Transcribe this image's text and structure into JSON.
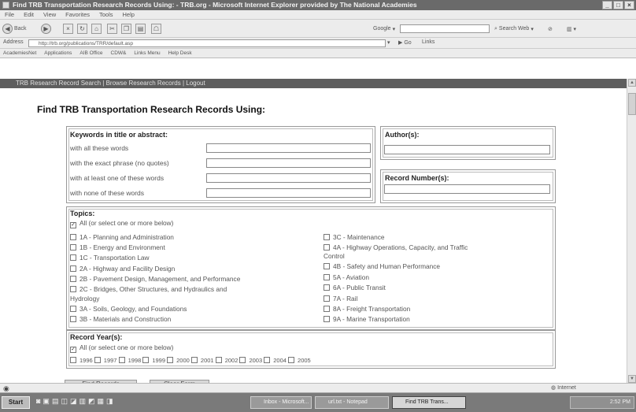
{
  "window": {
    "title": "Find TRB Transportation Research Records Using: - TRB.org - Microsoft Internet Explorer provided by The National Academies"
  },
  "menu": [
    "File",
    "Edit",
    "View",
    "Favorites",
    "Tools",
    "Help"
  ],
  "toolbar": {
    "back_label": "Back",
    "google_label": "Google",
    "search_web_label": "Search Web"
  },
  "address": {
    "label": "Address",
    "url": "http://trb.org/publications/TRR/default.asp",
    "go_label": "Go",
    "links_label": "Links"
  },
  "links": [
    "AcademiesNet",
    "Applications",
    "AIB Office",
    "CDW&",
    "Links Menu",
    "Help Desk"
  ],
  "site_nav": "TRB Research Record Search | Browse Research Records | Logout",
  "page": {
    "heading": "Find TRB Transportation Research Records Using:",
    "keywords": {
      "title": "Keywords in title or abstract:",
      "rows": [
        {
          "label": "with all these words",
          "value": ""
        },
        {
          "label": "with the exact phrase (no quotes)",
          "value": ""
        },
        {
          "label": "with at least one of these words",
          "value": ""
        },
        {
          "label": "with none of these words",
          "value": ""
        }
      ]
    },
    "authors": {
      "title": "Author(s):",
      "value": ""
    },
    "record_numbers": {
      "title": "Record Number(s):",
      "value": ""
    },
    "topics": {
      "title": "Topics:",
      "all_label": "All (or select one or more below)",
      "left": [
        "1A - Planning and Administration",
        "1B - Energy and Environment",
        "1C - Transportation Law",
        "2A - Highway and Facility Design",
        "2B - Pavement Design, Management, and Performance",
        "2C - Bridges, Other Structures, and Hydraulics and",
        "3A - Soils, Geology, and Foundations",
        "3B - Materials and Construction"
      ],
      "left_wrap": "Hydrology",
      "right": [
        "3C - Maintenance",
        "4A - Highway Operations, Capacity, and Traffic",
        "4B - Safety and Human Performance",
        "5A - Aviation",
        "6A - Public Transit",
        "7A - Rail",
        "8A - Freight Transportation",
        "9A - Marine Transportation"
      ],
      "right_wrap": "Control"
    },
    "years": {
      "title": "Record Year(s):",
      "all_label": "All (or select one or more below)",
      "list": [
        "1996",
        "1997",
        "1998",
        "1999",
        "2000",
        "2001",
        "2002",
        "2003",
        "2004",
        "2005"
      ]
    },
    "buttons": {
      "find": "Find Records",
      "clear": "Clear Form"
    }
  },
  "status": {
    "zone": "Internet"
  },
  "taskbar": {
    "start": "Start",
    "items": [
      "Inbox - Microsoft...",
      "url.txt - Notepad",
      "Find TRB Trans..."
    ],
    "clock": "2:52 PM"
  }
}
